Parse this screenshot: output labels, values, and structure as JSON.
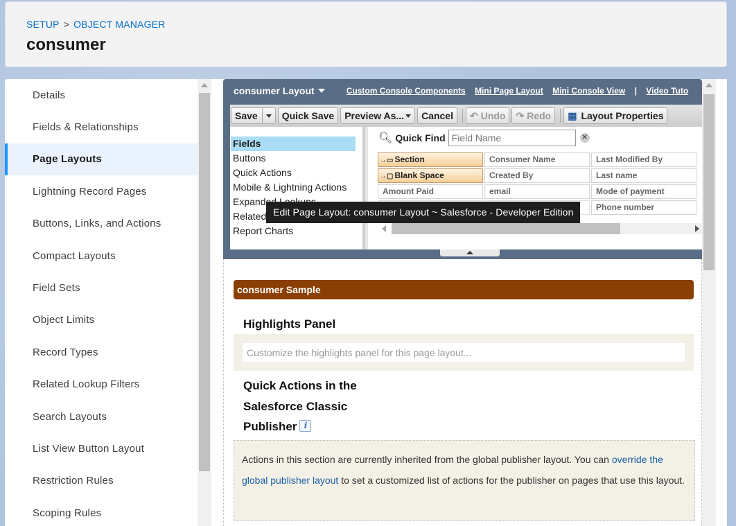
{
  "header": {
    "breadcrumb": {
      "setup": "SETUP",
      "separator": ">",
      "object_manager": "OBJECT MANAGER"
    },
    "title": "consumer"
  },
  "sidebar": {
    "items": [
      {
        "label": "Details"
      },
      {
        "label": "Fields & Relationships"
      },
      {
        "label": "Page Layouts"
      },
      {
        "label": "Lightning Record Pages"
      },
      {
        "label": "Buttons, Links, and Actions"
      },
      {
        "label": "Compact Layouts"
      },
      {
        "label": "Field Sets"
      },
      {
        "label": "Object Limits"
      },
      {
        "label": "Record Types"
      },
      {
        "label": "Related Lookup Filters"
      },
      {
        "label": "Search Layouts"
      },
      {
        "label": "List View Button Layout"
      },
      {
        "label": "Restriction Rules"
      },
      {
        "label": "Scoping Rules"
      }
    ],
    "active_index": 2
  },
  "layout_editor": {
    "title": "consumer Layout",
    "links": [
      "Custom Console Components",
      "Mini Page Layout",
      "Mini Console View",
      "Video Tuto"
    ],
    "pipe": "|",
    "toolbar": {
      "save": "Save",
      "quick_save": "Quick Save",
      "preview_as": "Preview As...",
      "cancel": "Cancel",
      "undo": "Undo",
      "redo": "Redo",
      "layout_properties": "Layout Properties"
    },
    "palette_categories": [
      "Fields",
      "Buttons",
      "Quick Actions",
      "Mobile & Lightning Actions",
      "Expanded Lookups",
      "Related Lists",
      "Report Charts"
    ],
    "quick_find": {
      "label": "Quick Find",
      "placeholder": "Field Name",
      "clear": "✕"
    },
    "fields": [
      [
        "Section",
        "Consumer Name",
        "Last Modified By"
      ],
      [
        "Blank Space",
        "Created By",
        "Last name"
      ],
      [
        "Amount Paid",
        "email",
        "Mode of payment"
      ],
      [
        "",
        "",
        "Phone number"
      ]
    ]
  },
  "tooltip": "Edit Page Layout: consumer Layout ~ Salesforce - Developer Edition",
  "canvas": {
    "sample_bar": "consumer Sample",
    "highlights_title": "Highlights Panel",
    "highlights_placeholder": "Customize the highlights panel for this page layout...",
    "quick_actions_title": [
      "Quick Actions in the",
      "Salesforce Classic",
      "Publisher"
    ],
    "info_icon": "i",
    "qa_text_1": "Actions in this section are currently inherited from the global publisher layout. You can ",
    "qa_link": "override the global publisher layout",
    "qa_text_2": " to set a customized list of actions for the publisher on pages that use this layout."
  },
  "colors": {
    "accent": "#1b96ff",
    "link": "#006dcc",
    "editor_header": "#5a6d86",
    "sample_bar": "#8a3f04",
    "active_category": "#a9dcf5"
  }
}
